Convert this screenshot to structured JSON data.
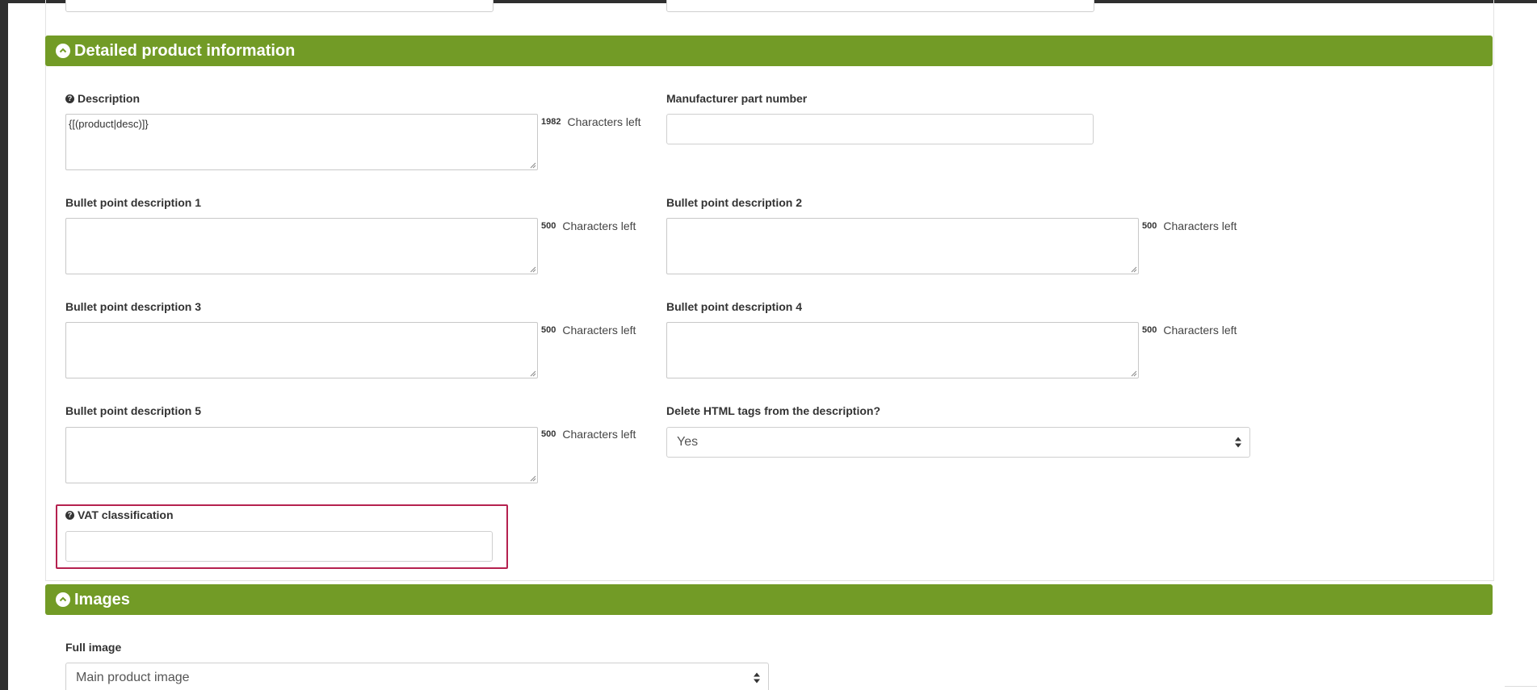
{
  "sections": {
    "detailed": {
      "title": "Detailed product information"
    },
    "images": {
      "title": "Images"
    }
  },
  "fields": {
    "description": {
      "label": "Description",
      "value": "{[(product|desc)]}",
      "count": "1982",
      "count_suffix": "Characters left"
    },
    "mpn": {
      "label": "Manufacturer part number",
      "value": ""
    },
    "bullet1": {
      "label": "Bullet point description 1",
      "value": "",
      "count": "500",
      "count_suffix": "Characters left"
    },
    "bullet2": {
      "label": "Bullet point description 2",
      "value": "",
      "count": "500",
      "count_suffix": "Characters left"
    },
    "bullet3": {
      "label": "Bullet point description 3",
      "value": "",
      "count": "500",
      "count_suffix": "Characters left"
    },
    "bullet4": {
      "label": "Bullet point description 4",
      "value": "",
      "count": "500",
      "count_suffix": "Characters left"
    },
    "bullet5": {
      "label": "Bullet point description 5",
      "value": "",
      "count": "500",
      "count_suffix": "Characters left"
    },
    "delete_html": {
      "label": "Delete HTML tags from the description?",
      "selected": "Yes"
    },
    "vat": {
      "label": "VAT classification",
      "value": ""
    },
    "full_image": {
      "label": "Full image",
      "selected": "Main product image"
    }
  },
  "colors": {
    "section_header": "#729b26",
    "highlight": "#b5214f"
  },
  "icons": {
    "collapse": "chevron-up-circle-icon",
    "help": "question-circle-icon",
    "select": "sort-arrows-icon"
  }
}
